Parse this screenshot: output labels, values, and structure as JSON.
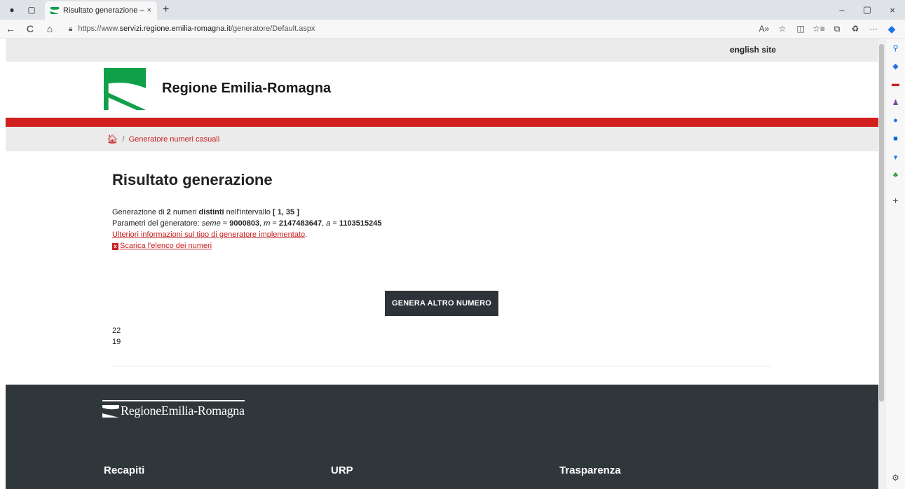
{
  "browser": {
    "tab_title": "Risultato generazione — E-R Il p",
    "url_prefix": "https://www.",
    "url_host": "servizi.regione.emilia-romagna.it",
    "url_path": "/generatore/Default.aspx",
    "back": "←",
    "refresh": "C",
    "home": "⌂",
    "new_tab": "+",
    "tab_close": "×",
    "min": "–",
    "restore": "▢",
    "close": "×"
  },
  "page": {
    "english_link": "english site",
    "site_title": "Regione Emilia-Romagna",
    "breadcrumb_sep": "/",
    "breadcrumb": "Generatore numeri casuali",
    "heading": "Risultato generazione",
    "info": {
      "line1_a": "Generazione di ",
      "count": "2",
      "line1_b": " numeri ",
      "distinct": "distinti",
      "line1_c": " nell'intervallo ",
      "range": "[ 1, 35 ]",
      "line2_a": "Parametri del generatore: ",
      "seed_label": "seme",
      "seed_eq": " = ",
      "seed": "9000803",
      "m_sep": ", ",
      "m_label": "m",
      "m_eq": " = ",
      "m": "2147483647",
      "a_sep": ", ",
      "a_label": "a",
      "a_eq": " = ",
      "a": "1103515245",
      "more_link": "Ulteriori informazioni sul tipo di generatore implementato",
      "more_dot": ".",
      "download_link": "Scarica l'elenco dei numeri"
    },
    "button": "GENERA ALTRO NUMERO",
    "numbers": [
      "22",
      "19"
    ]
  },
  "footer": {
    "logo_text": "RegioneEmilia-Romagna",
    "cols": [
      "Recapiti",
      "URP",
      "Trasparenza"
    ]
  },
  "colors": {
    "accent": "#d2201f",
    "brand_green": "#10a04a",
    "footer": "#30373b"
  }
}
